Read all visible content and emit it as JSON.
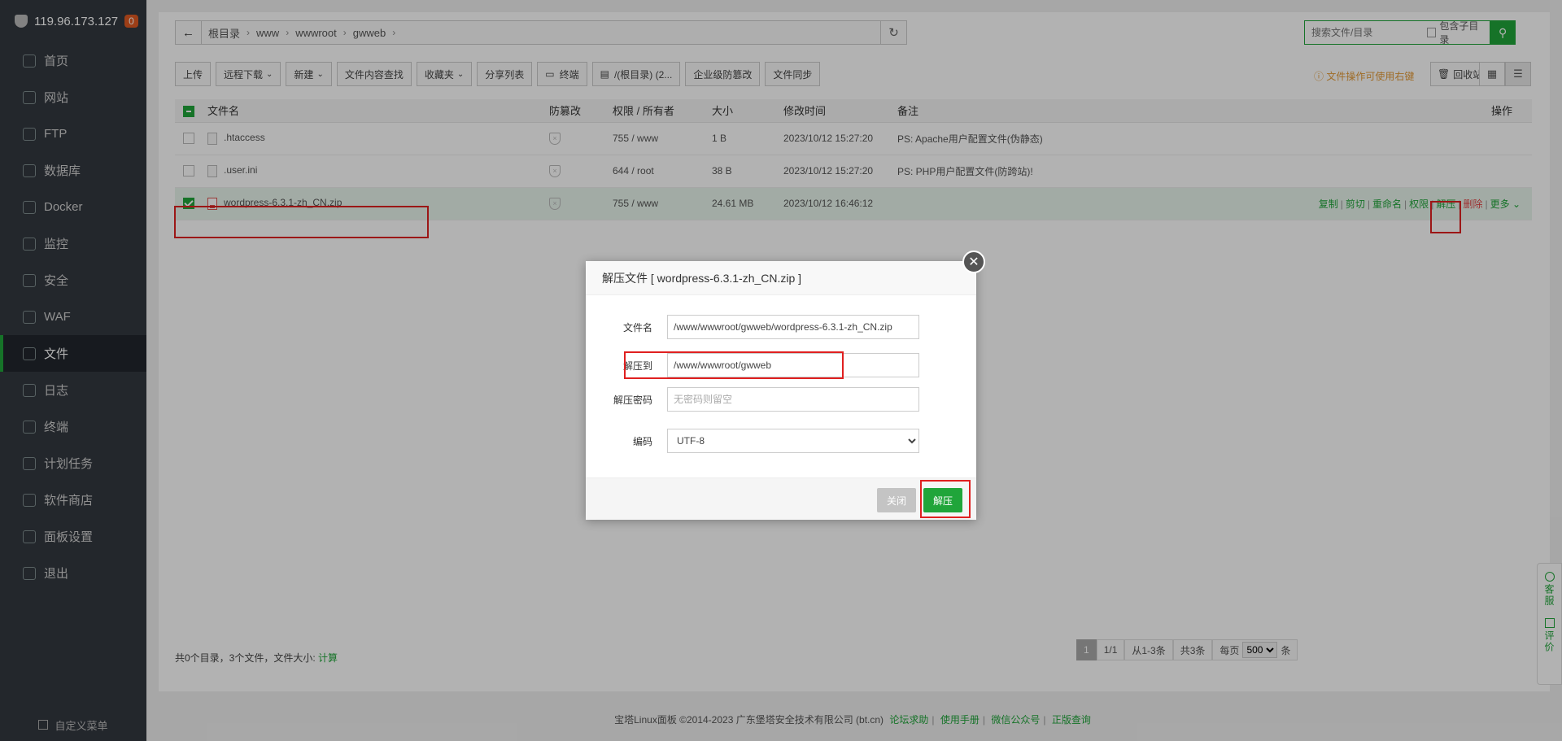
{
  "sidebar": {
    "server_ip": "119.96.173.127",
    "badge": "0",
    "items": [
      {
        "label": "首页",
        "icon": "home-icon"
      },
      {
        "label": "网站",
        "icon": "globe-icon"
      },
      {
        "label": "FTP",
        "icon": "ftp-icon"
      },
      {
        "label": "数据库",
        "icon": "database-icon"
      },
      {
        "label": "Docker",
        "icon": "docker-icon"
      },
      {
        "label": "监控",
        "icon": "monitor-icon"
      },
      {
        "label": "安全",
        "icon": "shield-icon"
      },
      {
        "label": "WAF",
        "icon": "waf-icon"
      },
      {
        "label": "文件",
        "icon": "folder-icon"
      },
      {
        "label": "日志",
        "icon": "log-icon"
      },
      {
        "label": "终端",
        "icon": "terminal-icon"
      },
      {
        "label": "计划任务",
        "icon": "calendar-icon"
      },
      {
        "label": "软件商店",
        "icon": "apps-icon"
      },
      {
        "label": "面板设置",
        "icon": "gear-icon"
      },
      {
        "label": "退出",
        "icon": "logout-icon"
      }
    ],
    "active_index": 8,
    "custom_menu": "自定义菜单"
  },
  "path": {
    "crumbs": [
      "根目录",
      "www",
      "wwwroot",
      "gwweb"
    ]
  },
  "search": {
    "placeholder": "搜索文件/目录",
    "subdir_label": "包含子目录"
  },
  "toolbar": {
    "upload": "上传",
    "remote_download": "远程下载",
    "new": "新建",
    "content_search": "文件内容查找",
    "favorites": "收藏夹",
    "share_list": "分享列表",
    "terminal": "终端",
    "disk": "/(根目录) (2...",
    "tamper": "企业级防篡改",
    "sync": "文件同步",
    "hint": "文件操作可使用右键",
    "recycle": "回收站"
  },
  "table": {
    "headers": {
      "name": "文件名",
      "tamper": "防篡改",
      "perm": "权限 / 所有者",
      "size": "大小",
      "mtime": "修改时间",
      "note": "备注",
      "ops": "操作"
    },
    "rows": [
      {
        "name": ".htaccess",
        "perm": "755 / www",
        "size": "1 B",
        "mtime": "2023/10/12 15:27:20",
        "note": "PS: Apache用户配置文件(伪静态)"
      },
      {
        "name": ".user.ini",
        "perm": "644 / root",
        "size": "38 B",
        "mtime": "2023/10/12 15:27:20",
        "note": "PS: PHP用户配置文件(防跨站)!"
      },
      {
        "name": "wordpress-6.3.1-zh_CN.zip",
        "perm": "755 / www",
        "size": "24.61 MB",
        "mtime": "2023/10/12 16:46:12",
        "note": ""
      }
    ],
    "ops": {
      "copy": "复制",
      "cut": "剪切",
      "rename": "重命名",
      "perm": "权限",
      "extract": "解压",
      "delete": "删除",
      "more": "更多"
    }
  },
  "summary": {
    "text": "共0个目录，3个文件，文件大小:",
    "calc": "计算"
  },
  "pager": {
    "page": "1",
    "pages": "1/1",
    "range": "从1-3条",
    "total": "共3条",
    "per_page_label": "每页",
    "per_page": "500",
    "unit": "条"
  },
  "footer": {
    "copyright": "宝塔Linux面板 ©2014-2023 广东堡塔安全技术有限公司 (bt.cn)",
    "links": [
      "论坛求助",
      "使用手册",
      "微信公众号",
      "正版查询"
    ]
  },
  "side_float": {
    "service": "客服",
    "review": "评价"
  },
  "dialog": {
    "title": "解压文件 [ wordpress-6.3.1-zh_CN.zip ]",
    "filename_label": "文件名",
    "filename_value": "/www/wwwroot/gwweb/wordpress-6.3.1-zh_CN.zip",
    "dest_label": "解压到",
    "dest_value": "/www/wwwroot/gwweb",
    "password_label": "解压密码",
    "password_placeholder": "无密码则留空",
    "encoding_label": "编码",
    "encoding_value": "UTF-8",
    "close_label": "关闭",
    "extract_label": "解压"
  }
}
